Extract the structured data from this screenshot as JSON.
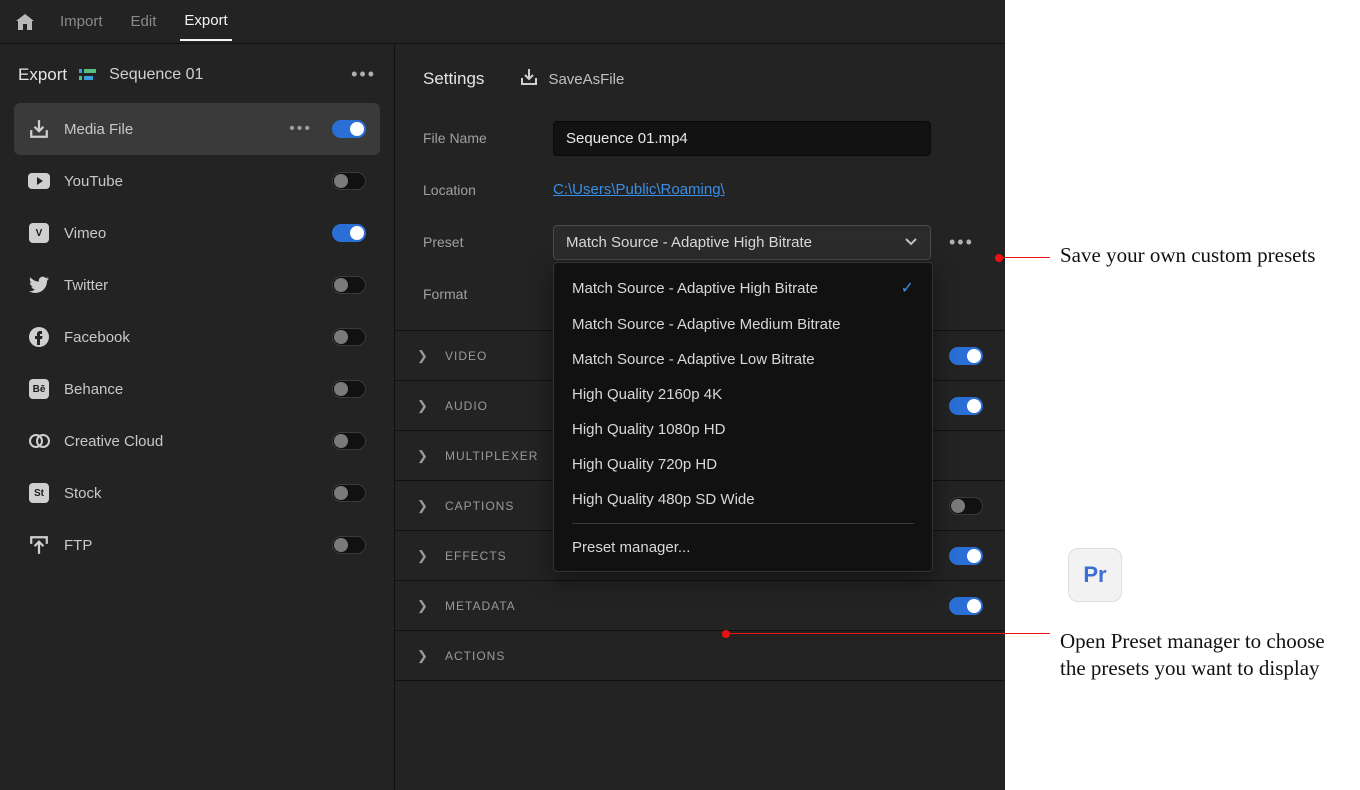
{
  "menu": {
    "import": "Import",
    "edit": "Edit",
    "export": "Export"
  },
  "sidebar": {
    "title": "Export",
    "sequence": "Sequence 01",
    "dests": [
      {
        "id": "media-file",
        "icon": "download-tray-icon",
        "label": "Media File",
        "dots": true,
        "on": true,
        "selected": true
      },
      {
        "id": "youtube",
        "icon": "youtube-icon",
        "label": "YouTube",
        "dots": false,
        "on": false,
        "selected": false
      },
      {
        "id": "vimeo",
        "icon": "vimeo-icon",
        "label": "Vimeo",
        "dots": false,
        "on": true,
        "selected": false
      },
      {
        "id": "twitter",
        "icon": "twitter-icon",
        "label": "Twitter",
        "dots": false,
        "on": false,
        "selected": false
      },
      {
        "id": "facebook",
        "icon": "facebook-icon",
        "label": "Facebook",
        "dots": false,
        "on": false,
        "selected": false
      },
      {
        "id": "behance",
        "icon": "behance-icon",
        "label": "Behance",
        "dots": false,
        "on": false,
        "selected": false
      },
      {
        "id": "creative-cloud",
        "icon": "creative-cloud-icon",
        "label": "Creative Cloud",
        "dots": false,
        "on": false,
        "selected": false
      },
      {
        "id": "stock",
        "icon": "stock-icon",
        "label": "Stock",
        "dots": false,
        "on": false,
        "selected": false
      },
      {
        "id": "ftp",
        "icon": "ftp-icon",
        "label": "FTP",
        "dots": false,
        "on": false,
        "selected": false
      }
    ]
  },
  "settings": {
    "title": "Settings",
    "save_as": "SaveAsFile",
    "file_name_label": "File Name",
    "file_name_value": "Sequence 01.mp4",
    "location_label": "Location",
    "location_value": "C:\\Users\\Public\\Roaming\\",
    "preset_label": "Preset",
    "preset_value": "Match Source - Adaptive High Bitrate",
    "format_label": "Format",
    "preset_options": [
      {
        "label": "Match Source - Adaptive High Bitrate",
        "selected": true
      },
      {
        "label": "Match Source - Adaptive Medium Bitrate",
        "selected": false
      },
      {
        "label": "Match Source - Adaptive Low Bitrate",
        "selected": false
      },
      {
        "label": "High Quality 2160p 4K",
        "selected": false
      },
      {
        "label": "High Quality 1080p HD",
        "selected": false
      },
      {
        "label": "High Quality 720p HD",
        "selected": false
      },
      {
        "label": "High Quality 480p SD Wide",
        "selected": false
      }
    ],
    "preset_manager": "Preset manager...",
    "sections": [
      {
        "id": "video",
        "label": "VIDEO",
        "on": true,
        "toggle": true
      },
      {
        "id": "audio",
        "label": "AUDIO",
        "on": true,
        "toggle": true
      },
      {
        "id": "multiplexer",
        "label": "MULTIPLEXER",
        "on": false,
        "toggle": false
      },
      {
        "id": "captions",
        "label": "CAPTIONS",
        "on": false,
        "toggle": true
      },
      {
        "id": "effects",
        "label": "EFFECTS",
        "on": true,
        "toggle": true
      },
      {
        "id": "metadata",
        "label": "METADATA",
        "on": true,
        "toggle": true
      },
      {
        "id": "actions",
        "label": "ACTIONS",
        "on": false,
        "toggle": false
      }
    ]
  },
  "annotations": {
    "save_preset": "Save your own custom presets",
    "preset_manager": "Open Preset manager to choose the presets you want to display",
    "pr_badge": "Pr"
  }
}
